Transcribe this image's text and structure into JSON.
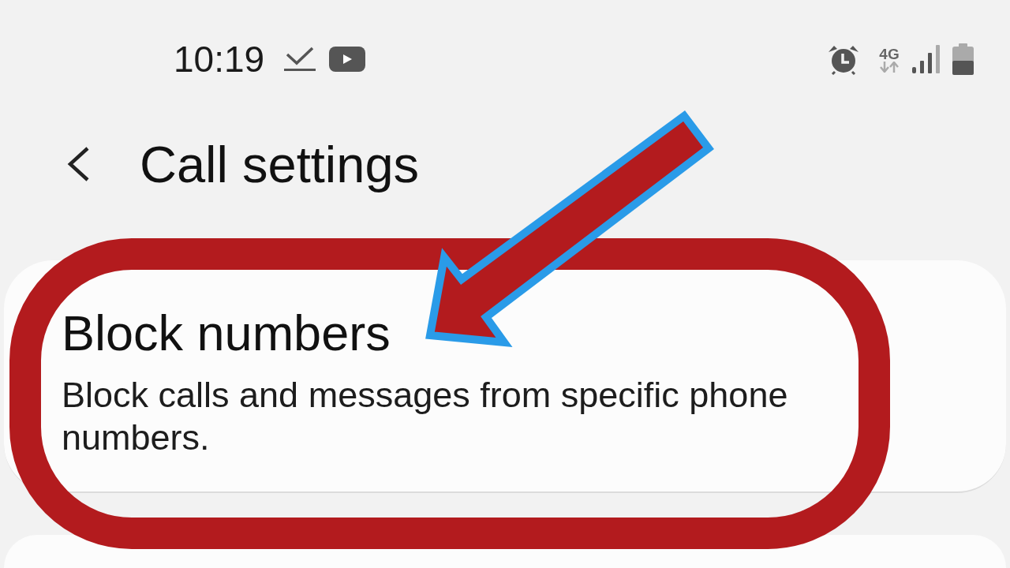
{
  "status_bar": {
    "time": "10:19",
    "network_type": "4G"
  },
  "header": {
    "title": "Call settings"
  },
  "settings": [
    {
      "title": "Block numbers",
      "summary": "Block calls and messages from specific phone numbers."
    }
  ],
  "annotations": [
    {
      "kind": "ring"
    },
    {
      "kind": "arrow"
    }
  ]
}
